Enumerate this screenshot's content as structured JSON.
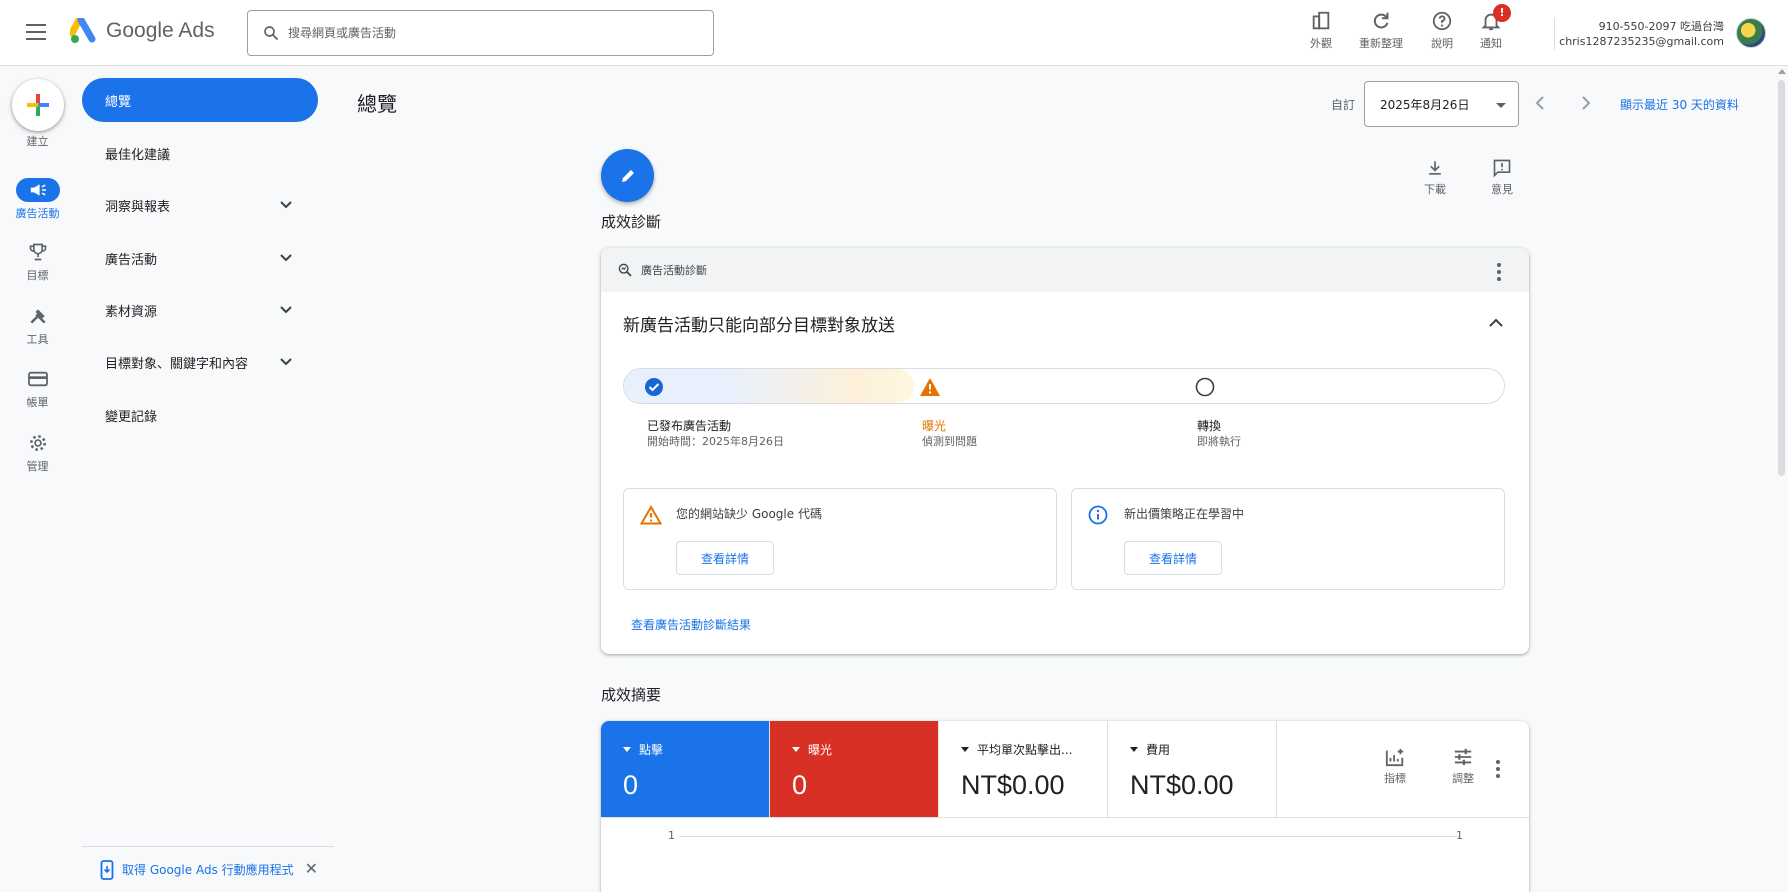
{
  "header": {
    "app_name": "Google Ads",
    "search_placeholder": "搜尋網頁或廣告活動",
    "tools": [
      {
        "label": "外觀",
        "icon": "appearance-icon"
      },
      {
        "label": "重新整理",
        "icon": "refresh-icon"
      },
      {
        "label": "說明",
        "icon": "help-icon"
      },
      {
        "label": "通知",
        "icon": "bell-icon"
      }
    ],
    "notification_badge": "!",
    "account_id": "910-550-2097 吃過台灣",
    "account_email": "chris1287235235@gmail.com"
  },
  "rail": {
    "create_label": "建立",
    "items": [
      {
        "label": "廣告活動",
        "icon": "megaphone-icon",
        "active": true
      },
      {
        "label": "目標",
        "icon": "trophy-icon"
      },
      {
        "label": "工具",
        "icon": "tools-icon"
      },
      {
        "label": "帳單",
        "icon": "credit-card-icon"
      },
      {
        "label": "管理",
        "icon": "gear-icon"
      }
    ]
  },
  "sidebar": {
    "items": [
      {
        "label": "總覽",
        "active": true
      },
      {
        "label": "最佳化建議"
      },
      {
        "label": "洞察與報表",
        "expandable": true
      },
      {
        "label": "廣告活動",
        "expandable": true
      },
      {
        "label": "素材資源",
        "expandable": true
      },
      {
        "label": "目標對象、關鍵字和內容",
        "expandable": true
      },
      {
        "label": "變更記錄"
      }
    ],
    "app_banner": "取得 Google Ads 行動應用程式",
    "app_banner_close": "✕"
  },
  "main": {
    "title": "總覽",
    "date_range_label": "自訂",
    "date_value": "2025年8月26日",
    "recent_link": "顯示最近 30 天的資料",
    "actions": [
      {
        "label": "下載",
        "icon": "download-icon"
      },
      {
        "label": "意見",
        "icon": "feedback-icon"
      }
    ],
    "diagnostics_section_title": "成效診斷",
    "summary_section_title": "成效摘要"
  },
  "diagnostics": {
    "header_label": "廣告活動診斷",
    "title": "新廣告活動只能向部分目標對象放送",
    "steps": [
      {
        "title": "已發布廣告活動",
        "sub": "開始時間：2025年8月26日",
        "status": "done"
      },
      {
        "title": "曝光",
        "sub": "偵測到問題",
        "status": "warning"
      },
      {
        "title": "轉換",
        "sub": "即將執行",
        "status": "pending"
      }
    ],
    "alerts": [
      {
        "message": "您的網站缺少 Google 代碼",
        "button": "查看詳情",
        "type": "warning"
      },
      {
        "message": "新出價策略正在學習中",
        "button": "查看詳情",
        "type": "info"
      }
    ],
    "link": "查看廣告活動診斷結果"
  },
  "summary": {
    "metrics": [
      {
        "name": "點擊",
        "value": "0",
        "color": "#1a73e8"
      },
      {
        "name": "曝光",
        "value": "0",
        "color": "#d93025"
      },
      {
        "name": "平均單次點擊出...",
        "value": "NT$0.00",
        "color": "#ffffff"
      },
      {
        "name": "費用",
        "value": "NT$0.00",
        "color": "#ffffff"
      }
    ],
    "actions": [
      {
        "label": "指標",
        "icon": "add-chart-icon"
      },
      {
        "label": "調整",
        "icon": "tune-icon"
      }
    ],
    "axis_left": "1",
    "axis_right": "1"
  },
  "colors": {
    "accent": "#1a73e8",
    "danger": "#d93025",
    "warning": "#e37400"
  }
}
